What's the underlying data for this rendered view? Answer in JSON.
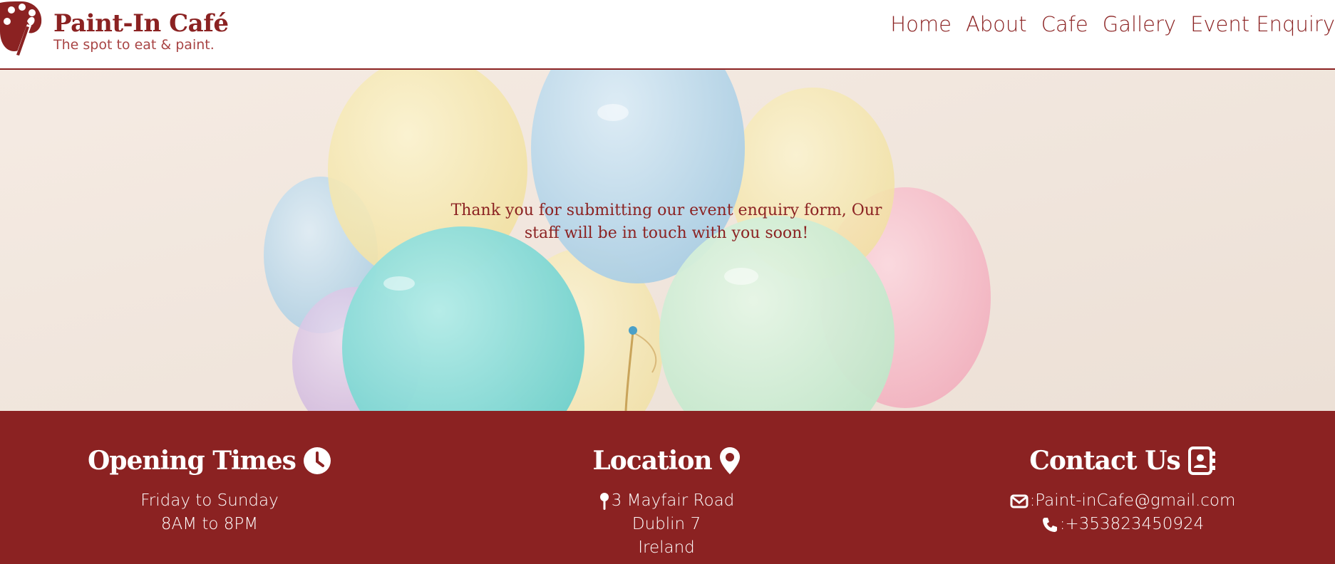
{
  "brand": {
    "name": "Paint-In Café",
    "tagline": "The spot to eat & paint."
  },
  "nav": {
    "items": [
      "Home",
      "About",
      "Cafe",
      "Gallery",
      "Event Enquiry"
    ]
  },
  "hero": {
    "message_line1": "Thank you for submitting our event enquiry form, Our",
    "message_line2": "staff will be in touch with you soon!"
  },
  "footer": {
    "opening": {
      "heading": "Opening Times",
      "icon": "clock-icon",
      "lines": [
        "Friday to Sunday",
        "8AM to 8PM"
      ]
    },
    "location": {
      "heading": "Location",
      "icon": "map-marker-icon",
      "address": [
        "3 Mayfair Road",
        "Dublin 7",
        "Ireland"
      ]
    },
    "contact": {
      "heading": "Contact Us",
      "icon": "address-book-icon",
      "email": ":Paint-inCafe@gmail.com",
      "phone": ":+353823450924"
    }
  },
  "colors": {
    "brand": "#8b2222",
    "footer_bg": "#8b2222",
    "header_bg": "#ffffff",
    "footer_text": "#ffffff"
  }
}
